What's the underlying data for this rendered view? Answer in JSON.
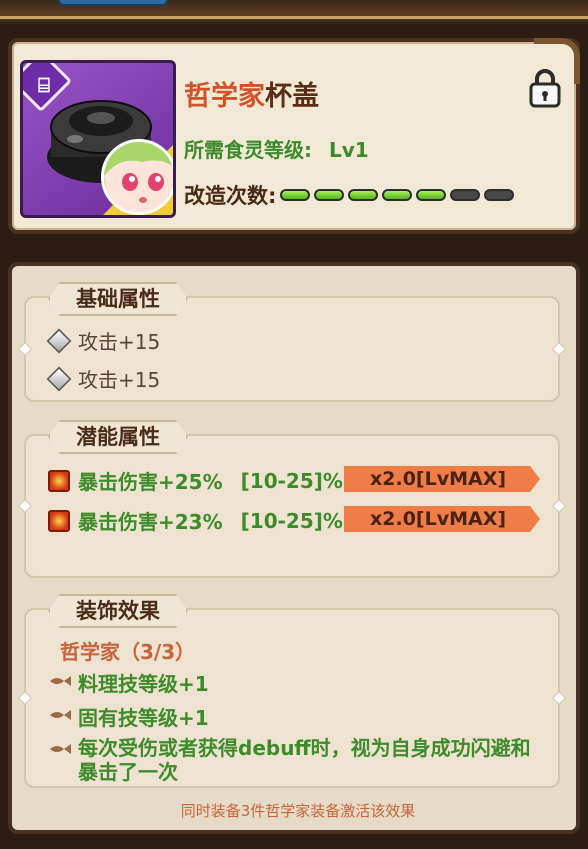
{
  "item": {
    "name_prefix": "哲学家",
    "name_suffix": "杯盖",
    "required_level_label": "所需食灵等级:",
    "required_level_value": "Lv1",
    "modify_count_label": "改造次数:",
    "modify_progress": {
      "filled": 5,
      "total": 7
    },
    "icons": {
      "badge": "spatula-icon",
      "lock": "lock-icon",
      "portrait": "character-portrait"
    }
  },
  "basic_attributes": {
    "title": "基础属性",
    "rows": [
      {
        "text": "攻击+15"
      },
      {
        "text": "攻击+15"
      }
    ]
  },
  "potential_attributes": {
    "title": "潜能属性",
    "rows": [
      {
        "text": "暴击伤害+25%",
        "range": "[10-25]%",
        "tag": "x2.0[LvMAX]"
      },
      {
        "text": "暴击伤害+23%",
        "range": "[10-25]%",
        "tag": "x2.0[LvMAX]"
      }
    ]
  },
  "decor_effect": {
    "title": "装饰效果",
    "set_name": "哲学家（3/3）",
    "effects": [
      {
        "text": "料理技等级+1"
      },
      {
        "text": "固有技等级+1"
      },
      {
        "text": "每次受伤或者获得debuff时，视为自身成功闪避和暴击了一次"
      }
    ],
    "footer": "同时装备3件哲学家装备激活该效果"
  },
  "colors": {
    "title_orange": "#d2532a",
    "green_text": "#3d8a2a",
    "max_tag": "#ee7d47",
    "frame_purple": "#7a3bb0"
  }
}
